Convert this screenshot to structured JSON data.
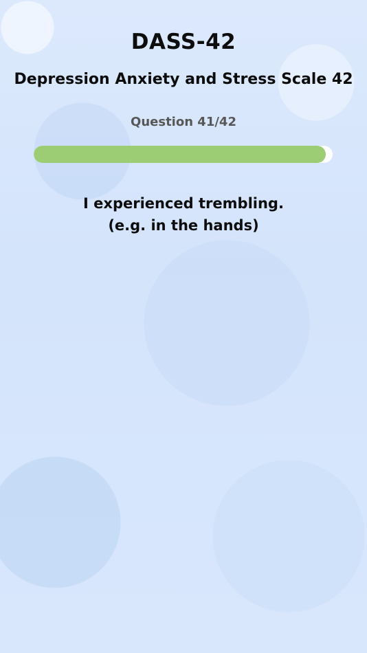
{
  "header": {
    "title": "DASS-42",
    "subtitle": "Depression Anxiety and Stress Scale 42"
  },
  "progress": {
    "label": "Question 41/42",
    "current": 41,
    "total": 42,
    "fraction": 0.976
  },
  "question": {
    "line1": "I experienced trembling.",
    "line2": "(e.g. in the hands)"
  },
  "colors": {
    "progress_fill": "#9ccc74",
    "progress_track": "#ffffff",
    "background": "#d9e7fb",
    "title_text": "#0d0d0d",
    "counter_text": "#575757"
  }
}
